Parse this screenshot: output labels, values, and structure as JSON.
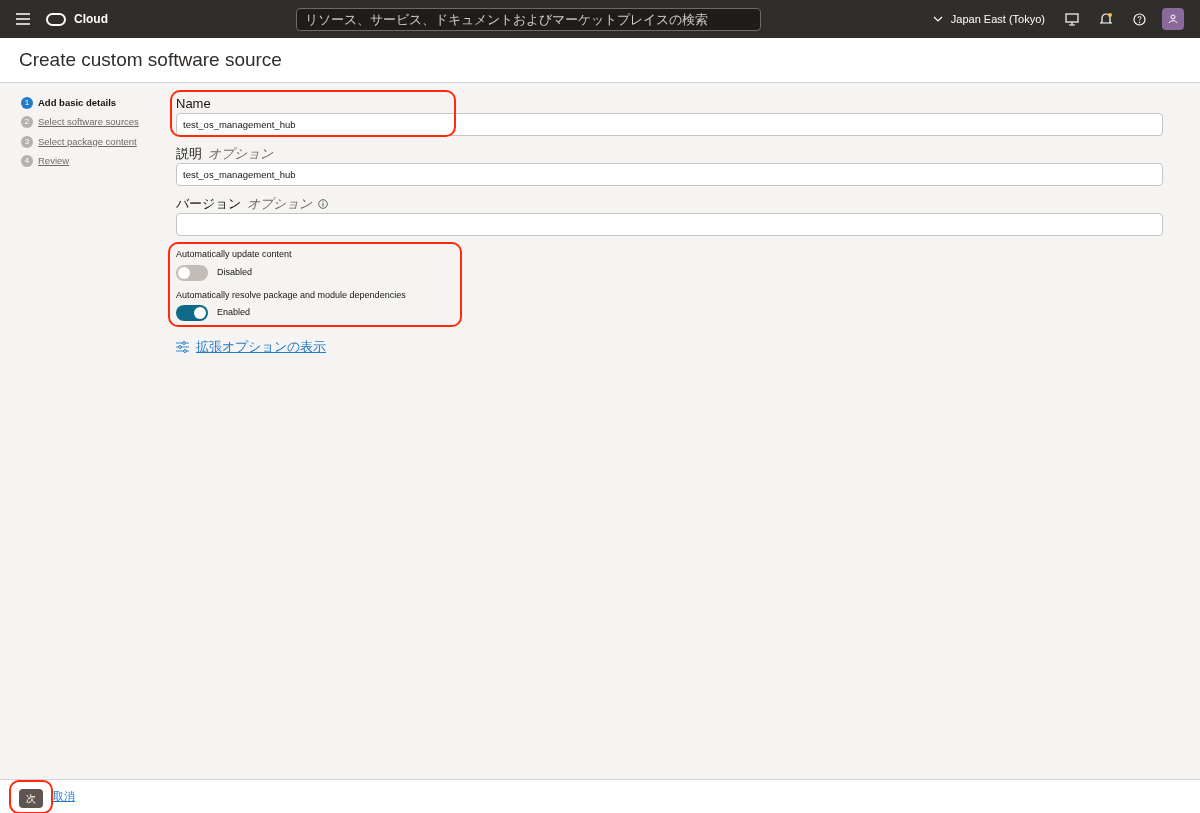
{
  "header": {
    "brand": "Cloud",
    "search": {
      "placeholder": "リソース、サービス、ドキュメントおよびマーケットプレイスの検索"
    },
    "region": "Japan East (Tokyo)"
  },
  "page": {
    "title": "Create custom software source"
  },
  "steps": [
    {
      "number": "1",
      "label": "Add basic details",
      "selected": true
    },
    {
      "number": "2",
      "label": "Select software sources",
      "selected": false
    },
    {
      "number": "3",
      "label": "Select package content",
      "selected": false
    },
    {
      "number": "4",
      "label": "Review",
      "selected": false
    }
  ],
  "fields": [
    {
      "label": "Name",
      "value": "test_os_management_hub",
      "highlighted": true
    },
    {
      "label": "説明",
      "optional": "オプション",
      "value": "test_os_management_hub",
      "highlighted": false
    },
    {
      "label": "バージョン",
      "optional": "オプション",
      "info": true,
      "highlighted": false
    }
  ],
  "toggles_highlighted": true,
  "toggles": [
    {
      "label": "Automatically update content",
      "on": false,
      "state_text": "Disabled"
    },
    {
      "label": "Automatically resolve package and module dependencies",
      "on": true,
      "state_text": "Enabled"
    }
  ],
  "advanced_link": "拡張オプションの表示",
  "footer": {
    "next": "次",
    "next_highlighted": true,
    "cancel": "取消"
  }
}
